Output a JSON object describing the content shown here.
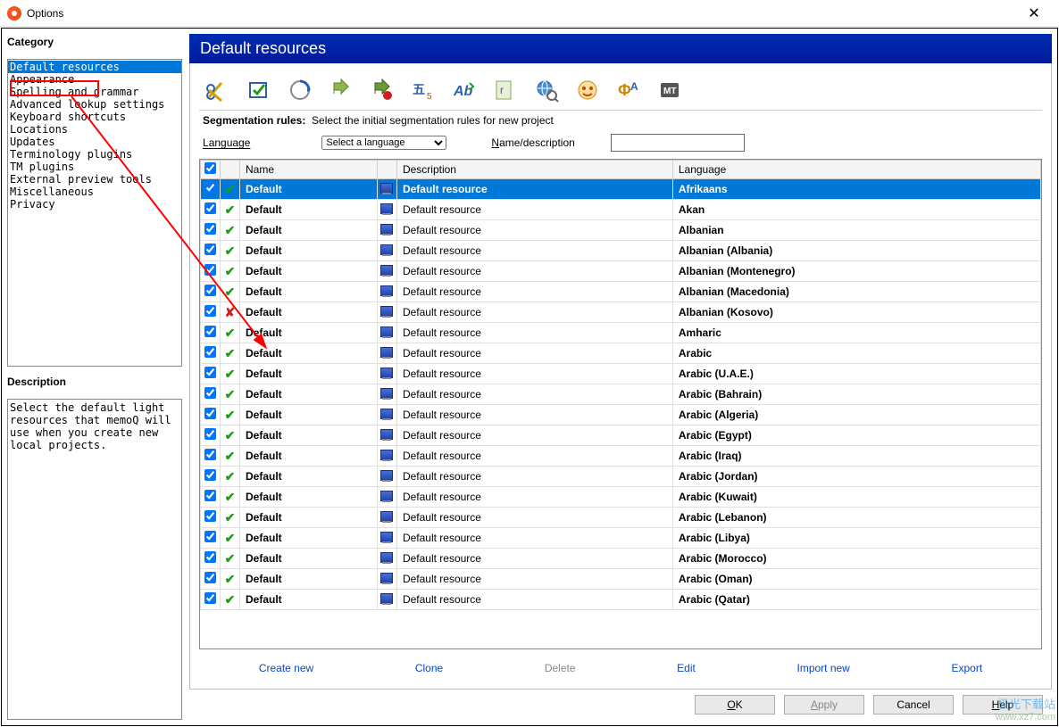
{
  "window": {
    "title": "Options"
  },
  "sidebar": {
    "category_label": "Category",
    "items": [
      "Default resources",
      "Appearance",
      "Spelling and grammar",
      "Advanced lookup settings",
      "Keyboard shortcuts",
      "Locations",
      "Updates",
      "Terminology plugins",
      "TM plugins",
      "External preview tools",
      "Miscellaneous",
      "Privacy"
    ],
    "selected_index": 0,
    "description_label": "Description",
    "description_text": "Select the default light resources that memoQ will use when you create new local projects."
  },
  "header": {
    "title": "Default resources"
  },
  "segmentation": {
    "label": "Segmentation rules:",
    "hint": "Select the initial segmentation rules for new project"
  },
  "filter": {
    "language_label": "Language",
    "language_select": "Select a language",
    "name_label": "Name/description",
    "name_value": ""
  },
  "columns": {
    "name": "Name",
    "description": "Description",
    "language": "Language"
  },
  "rows": [
    {
      "checked": true,
      "ok": true,
      "name": "Default",
      "desc": "Default resource",
      "lang": "Afrikaans",
      "selected": true
    },
    {
      "checked": true,
      "ok": true,
      "name": "Default",
      "desc": "Default resource",
      "lang": "Akan"
    },
    {
      "checked": true,
      "ok": true,
      "name": "Default",
      "desc": "Default resource",
      "lang": "Albanian"
    },
    {
      "checked": true,
      "ok": true,
      "name": "Default",
      "desc": "Default resource",
      "lang": "Albanian (Albania)"
    },
    {
      "checked": true,
      "ok": true,
      "name": "Default",
      "desc": "Default resource",
      "lang": "Albanian (Montenegro)"
    },
    {
      "checked": true,
      "ok": true,
      "name": "Default",
      "desc": "Default resource",
      "lang": "Albanian (Macedonia)"
    },
    {
      "checked": true,
      "ok": false,
      "name": "Default",
      "desc": "Default resource",
      "lang": "Albanian (Kosovo)"
    },
    {
      "checked": true,
      "ok": true,
      "name": "Default",
      "desc": "Default resource",
      "lang": "Amharic"
    },
    {
      "checked": true,
      "ok": true,
      "name": "Default",
      "desc": "Default resource",
      "lang": "Arabic"
    },
    {
      "checked": true,
      "ok": true,
      "name": "Default",
      "desc": "Default resource",
      "lang": "Arabic (U.A.E.)"
    },
    {
      "checked": true,
      "ok": true,
      "name": "Default",
      "desc": "Default resource",
      "lang": "Arabic (Bahrain)"
    },
    {
      "checked": true,
      "ok": true,
      "name": "Default",
      "desc": "Default resource",
      "lang": "Arabic (Algeria)"
    },
    {
      "checked": true,
      "ok": true,
      "name": "Default",
      "desc": "Default resource",
      "lang": "Arabic (Egypt)"
    },
    {
      "checked": true,
      "ok": true,
      "name": "Default",
      "desc": "Default resource",
      "lang": "Arabic (Iraq)"
    },
    {
      "checked": true,
      "ok": true,
      "name": "Default",
      "desc": "Default resource",
      "lang": "Arabic (Jordan)"
    },
    {
      "checked": true,
      "ok": true,
      "name": "Default",
      "desc": "Default resource",
      "lang": "Arabic (Kuwait)"
    },
    {
      "checked": true,
      "ok": true,
      "name": "Default",
      "desc": "Default resource",
      "lang": "Arabic (Lebanon)"
    },
    {
      "checked": true,
      "ok": true,
      "name": "Default",
      "desc": "Default resource",
      "lang": "Arabic (Libya)"
    },
    {
      "checked": true,
      "ok": true,
      "name": "Default",
      "desc": "Default resource",
      "lang": "Arabic (Morocco)"
    },
    {
      "checked": true,
      "ok": true,
      "name": "Default",
      "desc": "Default resource",
      "lang": "Arabic (Oman)"
    },
    {
      "checked": true,
      "ok": true,
      "name": "Default",
      "desc": "Default resource",
      "lang": "Arabic (Qatar)"
    }
  ],
  "actions": {
    "create": "Create new",
    "clone": "Clone",
    "delete": "Delete",
    "edit": "Edit",
    "import": "Import new",
    "export": "Export"
  },
  "buttons": {
    "ok": "OK",
    "apply": "Apply",
    "cancel": "Cancel",
    "help": "Help"
  },
  "watermark": {
    "line1": "极光下载站",
    "line2": "www.xz7.com"
  }
}
